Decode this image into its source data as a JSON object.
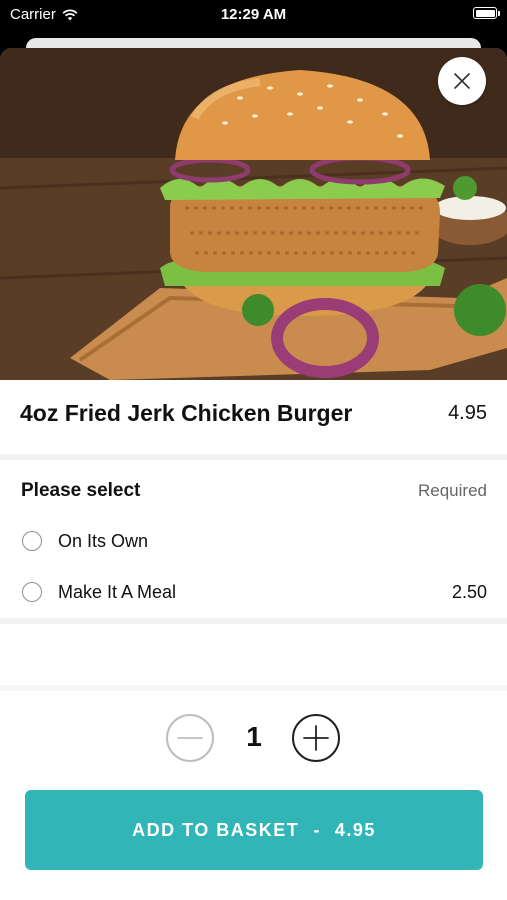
{
  "status_bar": {
    "carrier": "Carrier",
    "time": "12:29 AM",
    "icons": [
      "wifi-icon",
      "battery-icon"
    ]
  },
  "hero_image": {
    "subject": "fried chicken burger on wooden board",
    "close_icon": "close-icon"
  },
  "item": {
    "title": "4oz Fried Jerk Chicken Burger",
    "price": "4.95"
  },
  "options": {
    "title": "Please select",
    "required_label": "Required",
    "items": [
      {
        "label": "On Its Own",
        "price": ""
      },
      {
        "label": "Make It A Meal",
        "price": "2.50"
      }
    ]
  },
  "quantity": {
    "value": "1",
    "minus_icon": "minus-icon",
    "plus_icon": "plus-icon"
  },
  "add_button": {
    "label": "ADD TO BASKET",
    "separator": "-",
    "price": "4.95"
  },
  "colors": {
    "accent": "#31b5b6",
    "text": "#111111",
    "muted": "#666666"
  }
}
